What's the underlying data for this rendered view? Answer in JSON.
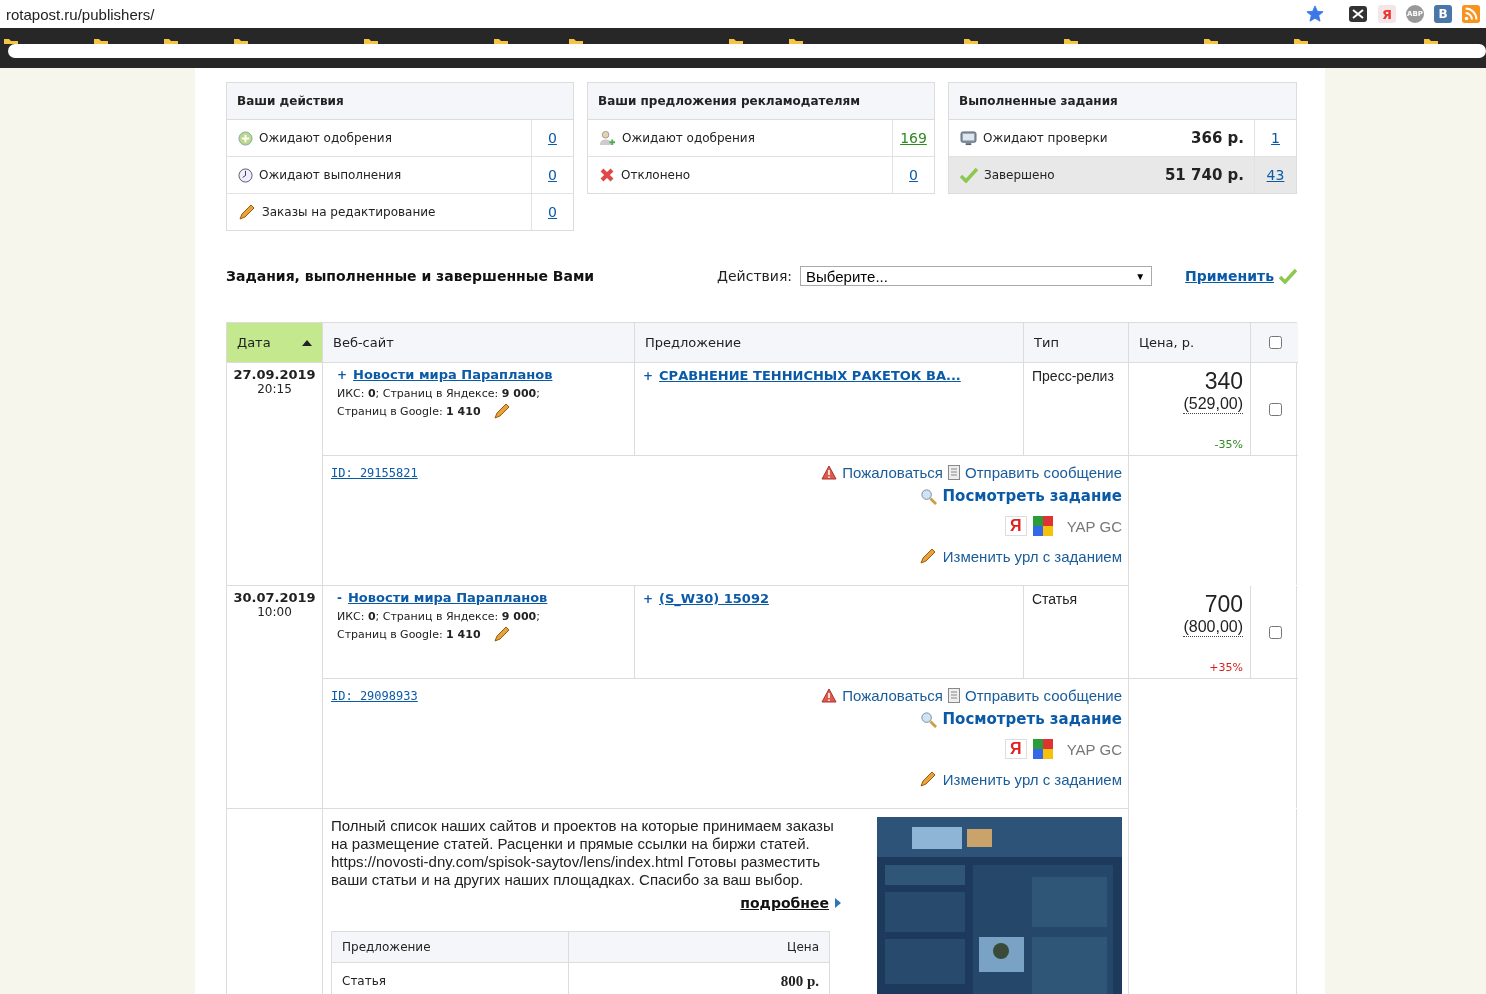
{
  "browser": {
    "url": "rotapost.ru/publishers/",
    "bookmarked": true,
    "extensions": [
      "Я",
      "ABP",
      "B"
    ]
  },
  "panels": [
    {
      "title": "Ваши действия",
      "rows": [
        {
          "label": "Ожидают одобрения",
          "count": "0",
          "color": "#0b5aa8"
        },
        {
          "label": "Ожидают выполнения",
          "count": "0",
          "color": "#0b5aa8"
        },
        {
          "label": "Заказы на редактирование",
          "count": "0",
          "color": "#0b5aa8"
        }
      ]
    },
    {
      "title": "Ваши предложения рекламодателям",
      "rows": [
        {
          "label": "Ожидают одобрения",
          "count": "169",
          "color": "#2e8b1f"
        },
        {
          "label": "Отклонено",
          "count": "0",
          "color": "#0b5aa8"
        }
      ]
    },
    {
      "title": "Выполненные задания",
      "rows": [
        {
          "label": "Ожидают проверки",
          "amount": "366 р.",
          "count": "1",
          "color": "#0b5aa8",
          "selected": false
        },
        {
          "label": "Завершено",
          "amount": "51 740 р.",
          "count": "43",
          "color": "#0b5aa8",
          "selected": true
        }
      ]
    }
  ],
  "actions_bar": {
    "heading": "Задания, выполненные и завершенные Вами",
    "label": "Действия:",
    "select": "Выберите...",
    "select_arrow": "▼",
    "apply": "Применить"
  },
  "table": {
    "columns": [
      {
        "label": "Дата",
        "sorted": true
      },
      {
        "label": "Веб-сайт",
        "sorted": false
      },
      {
        "label": "Предложение",
        "sorted": false
      },
      {
        "label": "Тип",
        "sorted": false
      },
      {
        "label": "Цена, р.",
        "sorted": false
      }
    ],
    "select_all": {
      "checked": false
    },
    "rows": [
      {
        "date": "27.09.2019",
        "time": "20:15",
        "site_prefix": "+",
        "site": "Новости мира Парапланов",
        "stats_1": "ИКС: **0**; Страниц в Яндексе: **9 000**;",
        "stats_2": "Страниц в Google: **1 410**",
        "offer_prefix": "+",
        "offer": "СРАВНЕНИЕ ТЕННИСНЫХ РАКЕТОК ВА...",
        "type": "Пресс-релиз",
        "price": "340",
        "base_price": "(529,00)",
        "change": "-35%",
        "color": "#2e8b1f",
        "checked": false,
        "id": "ID: 29155821",
        "complain": "Пожаловаться",
        "message": "Отправить сообщение",
        "view": "Посмотреть задание",
        "yandex": "Я",
        "index": "YAP GC",
        "edit": "Изменить урл с заданием"
      },
      {
        "date": "30.07.2019",
        "time": "10:00",
        "site_prefix": "-",
        "site": "Новости мира Парапланов",
        "stats_1": "ИКС: **0**; Страниц в Яндексе: **9 000**;",
        "stats_2": "Страниц в Google: **1 410**",
        "offer_prefix": "+",
        "offer": "(S_W30) 15092",
        "type": "Статья",
        "price": "700",
        "base_price": "(800,00)",
        "change": "+35%",
        "color": "#d42020",
        "checked": false,
        "id": "ID: 29098933",
        "complain": "Пожаловаться",
        "message": "Отправить сообщение",
        "view": "Посмотреть задание",
        "yandex": "Я",
        "index": "YAP GC",
        "edit": "Изменить урл с заданием"
      }
    ],
    "site_info": {
      "description": "Полный список наших сайтов и проектов на которые принимаем заказы на размещение статей. Расценки и прямые ссылки на биржи статей. https://novosti-dny.com/spisok-saytov/lens/index.html Готовы разместить ваши статьи и на других наших площадках. Спасибо за ваш выбор.",
      "more": "подробнее",
      "offers_columns": [
        "Предложение",
        "Цена"
      ],
      "offers": [
        {
          "name": "Статья",
          "price": "800 р."
        }
      ],
      "preview": {
        "kind": "picture"
      }
    }
  }
}
